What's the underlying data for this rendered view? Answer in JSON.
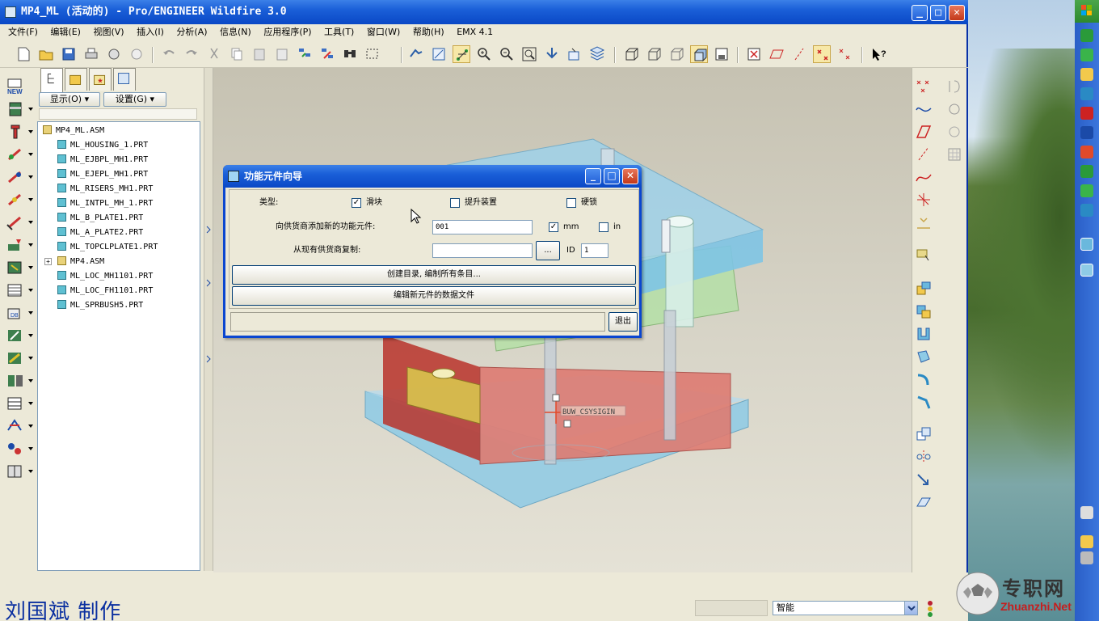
{
  "window": {
    "title": "MP4_ML (活动的) - Pro/ENGINEER Wildfire 3.0",
    "minimize": "_",
    "maximize": "□",
    "close": "✕"
  },
  "menu": [
    "文件(F)",
    "编辑(E)",
    "视图(V)",
    "插入(I)",
    "分析(A)",
    "信息(N)",
    "应用程序(P)",
    "工具(T)",
    "窗口(W)",
    "帮助(H)",
    "EMX 4.1"
  ],
  "navigator": {
    "show_label": "显示(O)",
    "settings_label": "设置(G)",
    "tree": [
      {
        "label": "MP4_ML.ASM",
        "type": "asm",
        "level": 0
      },
      {
        "label": "ML_HOUSING_1.PRT",
        "type": "prt",
        "level": 1
      },
      {
        "label": "ML_EJBPL_MH1.PRT",
        "type": "prt",
        "level": 1
      },
      {
        "label": "ML_EJEPL_MH1.PRT",
        "type": "prt",
        "level": 1
      },
      {
        "label": "ML_RISERS_MH1.PRT",
        "type": "prt",
        "level": 1
      },
      {
        "label": "ML_INTPL_MH_1.PRT",
        "type": "prt",
        "level": 1
      },
      {
        "label": "ML_B_PLATE1.PRT",
        "type": "prt",
        "level": 1
      },
      {
        "label": "ML_A_PLATE2.PRT",
        "type": "prt",
        "level": 1
      },
      {
        "label": "ML_TOPCLPLATE1.PRT",
        "type": "prt",
        "level": 1
      },
      {
        "label": "MP4.ASM",
        "type": "asm",
        "level": 1,
        "expandable": true
      },
      {
        "label": "ML_LOC_MH1101.PRT",
        "type": "prt",
        "level": 1
      },
      {
        "label": "ML_LOC_FH1101.PRT",
        "type": "prt",
        "level": 1
      },
      {
        "label": "ML_SPRBUSH5.PRT",
        "type": "prt",
        "level": 1
      }
    ]
  },
  "dialog": {
    "title": "功能元件向导",
    "type_label": "类型:",
    "opt_slider": "滑块",
    "opt_slider_checked": true,
    "opt_lifter": "提升装置",
    "opt_lifter_checked": false,
    "opt_lock": "硬锁",
    "opt_lock_checked": false,
    "add_label": "向供货商添加新的功能元件:",
    "add_value": "001",
    "unit_mm": "mm",
    "unit_mm_checked": true,
    "unit_in": "in",
    "unit_in_checked": false,
    "copy_label": "从现有供货商复制:",
    "copy_value": "",
    "browse_label": "...",
    "id_label": "ID",
    "id_value": "1",
    "create_btn": "创建目录, 编制所有条目...",
    "edit_btn": "编辑新元件的数据文件",
    "status_text": "",
    "exit_btn": "退出"
  },
  "graphics": {
    "csys_label": "BUW_CSYSIGIN"
  },
  "status": {
    "credit": "刘国斌 制作",
    "filter_value": "智能"
  },
  "watermark": {
    "brand": "专职网",
    "url": "Zhuanzhi.Net"
  },
  "colors": {
    "title_blue": "#0a48c6",
    "plate_blue": "#7ec4e4",
    "plate_green": "#9fd69a",
    "plate_red": "#d8706a",
    "plate_yellow": "#d8c45a"
  }
}
